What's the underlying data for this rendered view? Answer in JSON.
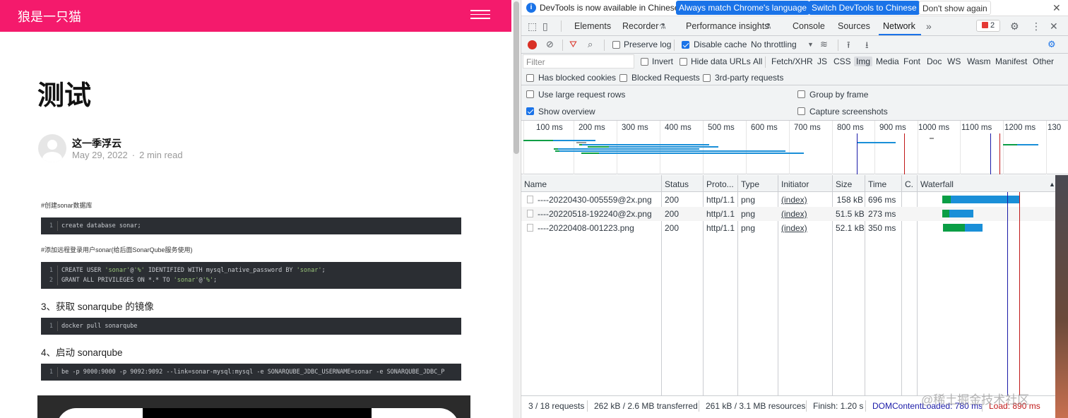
{
  "blog": {
    "site_title": "狼是一只猫",
    "post_title": "测试",
    "author": "这一季浮云",
    "date": "May 29, 2022",
    "read_time": "2 min read",
    "comment1": "#创建sonar数据库",
    "code1_line1": "create database sonar;",
    "comment2": "#添加远程登录用户sonar(给后面SonarQube服务使用)",
    "code2_line1_a": "CREATE USER ",
    "code2_line1_b": "'sonar'",
    "code2_line1_c": "@",
    "code2_line1_d": "'%'",
    "code2_line1_e": " IDENTIFIED WITH mysql_native_password BY ",
    "code2_line1_f": "'sonar'",
    "code2_line1_g": ";",
    "code2_line2_a": "GRANT ALL PRIVILEGES ON *.* TO ",
    "code2_line2_b": "'sonar'",
    "code2_line2_c": "@",
    "code2_line2_d": "'%'",
    "code2_line2_e": ";",
    "heading3": "3、获取 sonarqube 的镜像",
    "code3_line1": "docker pull sonarqube",
    "heading4": "4、启动 sonarqube",
    "code4_line1": "be -p 9000:9000 -p 9092:9092 --link=sonar-mysql:mysql -e SONARQUBE_JDBC_USERNAME=sonar -e SONARQUBE_JDBC_P",
    "ln1": "1",
    "ln2": "2"
  },
  "devtools": {
    "infobar": {
      "text": "DevTools is now available in Chinese!",
      "btn_match": "Always match Chrome's language",
      "btn_switch": "Switch DevTools to Chinese",
      "btn_dismiss": "Don't show again"
    },
    "tabs": [
      "Elements",
      "Recorder",
      "Performance insights",
      "Console",
      "Sources",
      "Network"
    ],
    "issues_count": "2",
    "toolbar": {
      "preserve_log": "Preserve log",
      "disable_cache": "Disable cache",
      "throttling": "No throttling"
    },
    "filter": {
      "placeholder": "Filter",
      "invert": "Invert",
      "hide_data_urls": "Hide data URLs",
      "types": [
        "All",
        "Fetch/XHR",
        "JS",
        "CSS",
        "Img",
        "Media",
        "Font",
        "Doc",
        "WS",
        "Wasm",
        "Manifest",
        "Other"
      ],
      "selected_type": "Img",
      "blocked_cookies": "Has blocked cookies",
      "blocked_requests": "Blocked Requests",
      "third_party": "3rd-party requests"
    },
    "settings": {
      "large_rows": "Use large request rows",
      "group_by_frame": "Group by frame",
      "show_overview": "Show overview",
      "capture_screenshots": "Capture screenshots"
    },
    "overview_ticks": [
      "100 ms",
      "200 ms",
      "300 ms",
      "400 ms",
      "500 ms",
      "600 ms",
      "700 ms",
      "800 ms",
      "900 ms",
      "1000 ms",
      "1100 ms",
      "1200 ms",
      "130"
    ],
    "columns": [
      "Name",
      "Status",
      "Proto...",
      "Type",
      "Initiator",
      "Size",
      "Time",
      "C.",
      "Waterfall"
    ],
    "rows": [
      {
        "name": "----20220430-005559@2x.png",
        "status": "200",
        "proto": "http/1.1",
        "type": "png",
        "initiator": "(index)",
        "size": "158 kB",
        "time": "696 ms"
      },
      {
        "name": "----20220518-192240@2x.png",
        "status": "200",
        "proto": "http/1.1",
        "type": "png",
        "initiator": "(index)",
        "size": "51.5 kB",
        "time": "273 ms"
      },
      {
        "name": "----20220408-001223.png",
        "status": "200",
        "proto": "http/1.1",
        "type": "png",
        "initiator": "(index)",
        "size": "52.1 kB",
        "time": "350 ms"
      }
    ],
    "status": {
      "requests": "3 / 18 requests",
      "transferred": "262 kB / 2.6 MB transferred",
      "resources": "261 kB / 3.1 MB resources",
      "finish": "Finish: 1.20 s",
      "dcl": "DOMContentLoaded: 780 ms",
      "load": "Load: 890 ms"
    },
    "colors": {
      "accent": "#1a73e8",
      "record": "#d93025",
      "green": "#0a9e45",
      "blue": "#1a8fd8",
      "dcl": "#1a1aa8",
      "load": "#c01818"
    }
  },
  "watermark": "@稀土掘金技术社区"
}
